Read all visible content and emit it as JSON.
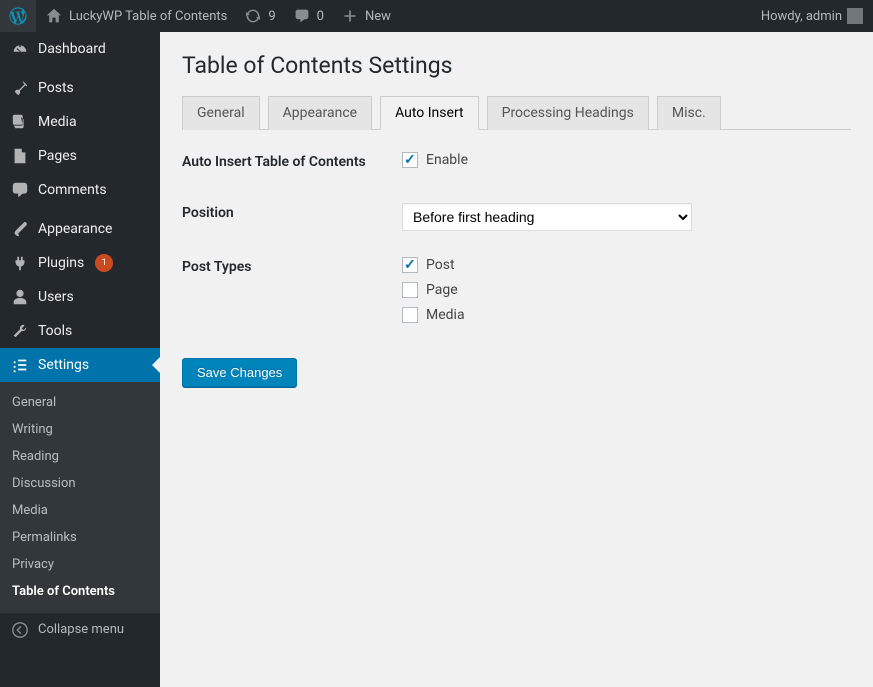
{
  "adminbar": {
    "site_name": "LuckyWP Table of Contents",
    "updates_count": "9",
    "comments_count": "0",
    "new_label": "New",
    "howdy": "Howdy, admin"
  },
  "sidebar": {
    "items": [
      {
        "icon": "dashboard",
        "label": "Dashboard"
      },
      {
        "sep": true
      },
      {
        "icon": "pin",
        "label": "Posts"
      },
      {
        "icon": "media",
        "label": "Media"
      },
      {
        "icon": "page",
        "label": "Pages"
      },
      {
        "icon": "comment",
        "label": "Comments"
      },
      {
        "sep": true
      },
      {
        "icon": "brush",
        "label": "Appearance"
      },
      {
        "icon": "plug",
        "label": "Plugins",
        "badge": "1"
      },
      {
        "icon": "user",
        "label": "Users"
      },
      {
        "icon": "wrench",
        "label": "Tools"
      },
      {
        "icon": "cog",
        "label": "Settings",
        "current": true
      }
    ],
    "submenu": [
      "General",
      "Writing",
      "Reading",
      "Discussion",
      "Media",
      "Permalinks",
      "Privacy",
      "Table of Contents"
    ],
    "submenu_current": 7,
    "collapse": "Collapse menu"
  },
  "page": {
    "title": "Table of Contents Settings",
    "tabs": [
      "General",
      "Appearance",
      "Auto Insert",
      "Processing Headings",
      "Misc."
    ],
    "tab_active": 2,
    "auto_insert_label": "Auto Insert Table of Contents",
    "enable_label": "Enable",
    "enable_checked": true,
    "position_label": "Position",
    "position_value": "Before first heading",
    "post_types_label": "Post Types",
    "post_types": [
      {
        "label": "Post",
        "checked": true
      },
      {
        "label": "Page",
        "checked": false
      },
      {
        "label": "Media",
        "checked": false
      }
    ],
    "save_label": "Save Changes"
  }
}
